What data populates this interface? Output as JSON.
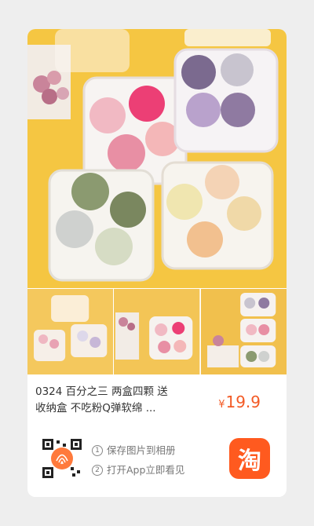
{
  "product": {
    "title_line1": "0324 百分之三 两盒四颗 送",
    "title_line2": "收纳盒 不吃粉Q弹软绵 ...",
    "price_symbol": "¥",
    "price_value": "19.9"
  },
  "actions": {
    "step1_num": "1",
    "step1_text": "保存图片到相册",
    "step2_num": "2",
    "step2_text": "打开App立即看见"
  },
  "app": {
    "logo_char": "淘"
  },
  "colors": {
    "accent": "#ff5a1f",
    "price": "#f35a25",
    "background": "#f5c642"
  }
}
